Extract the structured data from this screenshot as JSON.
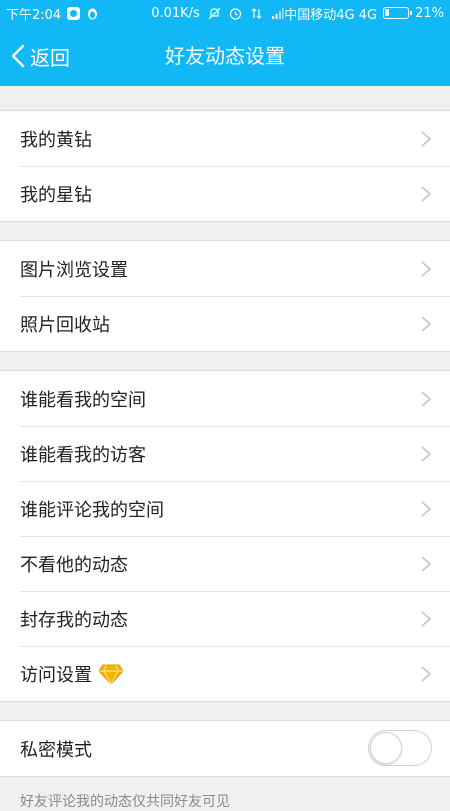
{
  "status_bar": {
    "time": "下午2:04",
    "speed": "0.01K/s",
    "carrier": "中国移动4G 4G",
    "battery_text": "21%",
    "battery_level": 0.21
  },
  "nav": {
    "back_label": "返回",
    "title": "好友动态设置"
  },
  "groups": [
    {
      "items": [
        {
          "label": "我的黄钻"
        },
        {
          "label": "我的星钻"
        }
      ]
    },
    {
      "items": [
        {
          "label": "图片浏览设置"
        },
        {
          "label": "照片回收站"
        }
      ]
    },
    {
      "items": [
        {
          "label": "谁能看我的空间"
        },
        {
          "label": "谁能看我的访客"
        },
        {
          "label": "谁能评论我的空间"
        },
        {
          "label": "不看他的动态"
        },
        {
          "label": "封存我的动态"
        },
        {
          "label": "访问设置",
          "badge_icon": "diamond-icon"
        }
      ]
    }
  ],
  "private_mode": {
    "label": "私密模式",
    "enabled": false
  },
  "footnote": "好友评论我的动态仅共同好友可见",
  "colors": {
    "accent": "#12b7f5",
    "background": "#f0f0f2",
    "chevron": "#c7c7cc",
    "diamond": "#f6b400"
  }
}
